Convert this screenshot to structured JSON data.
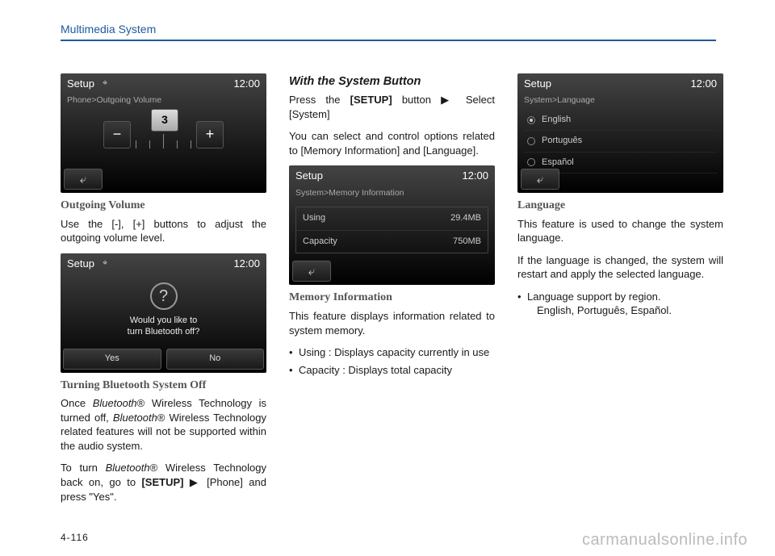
{
  "header": {
    "title": "Multimedia System"
  },
  "page_number": "4-116",
  "watermark": "carmanualsonline.info",
  "col1": {
    "screen1": {
      "title": "Setup",
      "clock": "12:00",
      "breadcrumb": "Phone>Outgoing Volume",
      "minus": "−",
      "plus": "+",
      "value": "3",
      "back": "⤶"
    },
    "h1": "Outgoing Volume",
    "p1": "Use the [-], [+] buttons to adjust the outgoing volume level.",
    "screen2": {
      "title": "Setup",
      "clock": "12:00",
      "q": "?",
      "line1": "Would you like to",
      "line2": "turn Bluetooth off?",
      "yes": "Yes",
      "no": "No"
    },
    "h2": "Turning Bluetooth System Off",
    "p2a": "Once ",
    "p2b": "Bluetooth",
    "p2c": "® Wireless Technology is turned off, ",
    "p2d": "Bluetooth",
    "p2e": "® Wireless Technology related features will not be supported within the audio system.",
    "p3a": "To turn ",
    "p3b": "Bluetooth",
    "p3c": "® Wireless Technology back on, go to ",
    "p3d": "[SETUP]",
    "p3e": " ▶ [Phone] and press \"Yes\"."
  },
  "col2": {
    "h1": "With the System Button",
    "p1a": "Press the ",
    "p1b": "[SETUP]",
    "p1c": " button ▶ Select [System]",
    "p2": "You can select and control options related to [Memory Information] and [Language].",
    "screen": {
      "title": "Setup",
      "clock": "12:00",
      "breadcrumb": "System>Memory Information",
      "row1k": "Using",
      "row1v": "29.4MB",
      "row2k": "Capacity",
      "row2v": "750MB",
      "back": "⤶"
    },
    "h2": "Memory Information",
    "p3": "This feature displays information related to system memory.",
    "li1": "Using : Displays capacity currently in use",
    "li2": "Capacity : Displays total capacity"
  },
  "col3": {
    "screen": {
      "title": "Setup",
      "clock": "12:00",
      "breadcrumb": "System>Language",
      "opt1": "English",
      "opt2": "Português",
      "opt3": "Español",
      "back": "⤶"
    },
    "h1": "Language",
    "p1": "This feature is used to change the system language.",
    "p2": "If the language is changed, the system will restart and apply the selected language.",
    "li1": "Language support by region.",
    "li1b": "English, Português, Español."
  }
}
